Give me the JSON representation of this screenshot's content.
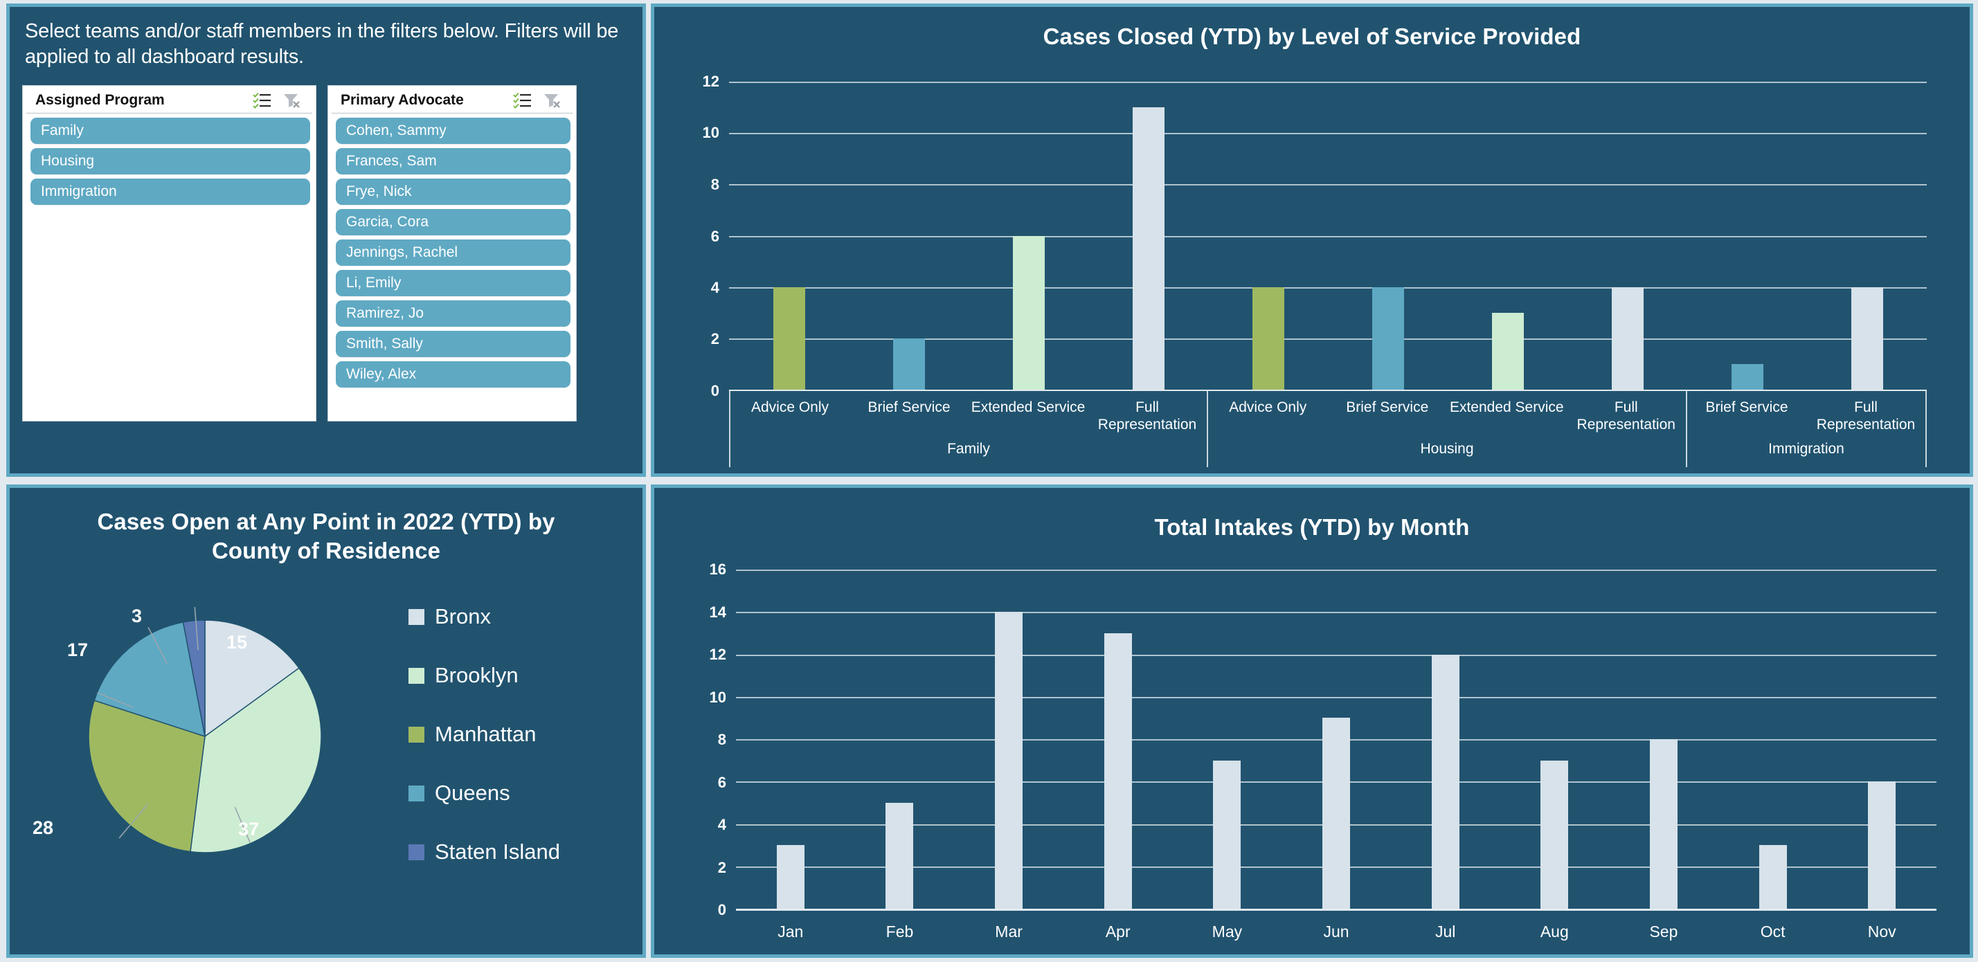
{
  "filters": {
    "note": "Select teams and/or staff members in the filters below. Filters will be applied to all dashboard results.",
    "slicers": [
      {
        "title": "Assigned Program",
        "multi_select_icon": "multi-select-icon",
        "clear_filter_icon": "clear-filter-icon",
        "items": [
          "Family",
          "Housing",
          "Immigration"
        ]
      },
      {
        "title": "Primary Advocate",
        "multi_select_icon": "multi-select-icon",
        "clear_filter_icon": "clear-filter-icon",
        "items": [
          "Cohen, Sammy",
          "Frances, Sam",
          "Frye, Nick",
          "Garcia, Cora",
          "Jennings, Rachel",
          "Li, Emily",
          "Ramirez, Jo",
          "Smith, Sally",
          "Wiley, Alex"
        ]
      }
    ]
  },
  "colors": {
    "panel_bg": "#21536F",
    "page_bg": "#E3EAEF",
    "accent_border": "#5FA9C3",
    "olive": "#9FB961",
    "teal": "#5FA9C3",
    "mint": "#CDEDD2",
    "pale_blue": "#D7E2EA",
    "slate_blue": "#5B79B5"
  },
  "chart_data": [
    {
      "type": "bar",
      "title": "Cases Closed (YTD) by Level of Service Provided",
      "xlabel": "",
      "ylabel": "",
      "ylim": [
        0,
        12
      ],
      "yticks": [
        0,
        2,
        4,
        6,
        8,
        10,
        12
      ],
      "grid": true,
      "legend": "none",
      "groups": [
        {
          "name": "Family",
          "categories": [
            "Advice Only",
            "Brief Service",
            "Extended Service",
            "Full Representation"
          ],
          "values": [
            4,
            2,
            6,
            11
          ],
          "colors": [
            "#9FB961",
            "#5FA9C3",
            "#CDEDD2",
            "#D7E2EA"
          ]
        },
        {
          "name": "Housing",
          "categories": [
            "Advice Only",
            "Brief Service",
            "Extended Service",
            "Full Representation"
          ],
          "values": [
            4,
            4,
            3,
            4
          ],
          "colors": [
            "#9FB961",
            "#5FA9C3",
            "#CDEDD2",
            "#D7E2EA"
          ]
        },
        {
          "name": "Immigration",
          "categories": [
            "Brief Service",
            "Full Representation"
          ],
          "values": [
            1,
            4
          ],
          "colors": [
            "#5FA9C3",
            "#D7E2EA"
          ]
        }
      ]
    },
    {
      "type": "pie",
      "title": "Cases Open at Any Point in 2022 (YTD) by County of Residence",
      "title_line1": "Cases Open at Any Point in 2022 (YTD) by",
      "title_line2": "County of Residence",
      "labels": [
        "Bronx",
        "Brooklyn",
        "Manhattan",
        "Queens",
        "Staten Island"
      ],
      "values": [
        15,
        37,
        28,
        17,
        3
      ],
      "colors": [
        "#D7E2EA",
        "#CDEDD2",
        "#9FB961",
        "#5FA9C3",
        "#5B79B5"
      ],
      "legend_position": "right",
      "data_labels": [
        "15",
        "37",
        "28",
        "17",
        "3"
      ]
    },
    {
      "type": "bar",
      "title": "Total Intakes (YTD) by Month",
      "xlabel": "",
      "ylabel": "",
      "ylim": [
        0,
        16
      ],
      "yticks": [
        0,
        2,
        4,
        6,
        8,
        10,
        12,
        14,
        16
      ],
      "grid": true,
      "categories": [
        "Jan",
        "Feb",
        "Mar",
        "Apr",
        "May",
        "Jun",
        "Jul",
        "Aug",
        "Sep",
        "Oct",
        "Nov"
      ],
      "values": [
        3,
        5,
        14,
        13,
        7,
        9,
        12,
        7,
        8,
        3,
        6
      ],
      "bar_color": "#D7E2EA"
    }
  ]
}
